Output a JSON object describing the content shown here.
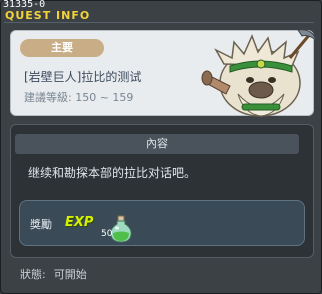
{
  "window": {
    "id_text": "31335-0",
    "title": "QUEST INFO"
  },
  "quest": {
    "tag": "主要",
    "name": "[岩壁巨人]拉比的测试",
    "level_label": "建議等級:",
    "level_range": "150 ~ 159",
    "npc_icon": "rock-giant-npc"
  },
  "content": {
    "header": "內容",
    "description": "继续和勘探本部的拉比对话吧。"
  },
  "reward": {
    "label": "獎勵",
    "exp_label": "EXP",
    "exp_value": "50",
    "icon": "green-potion-icon"
  },
  "status": {
    "label": "狀態:",
    "value": "可開始"
  },
  "colors": {
    "title": "#f4d23a",
    "exp": "#d6f000",
    "tag": "#c9ad86"
  }
}
